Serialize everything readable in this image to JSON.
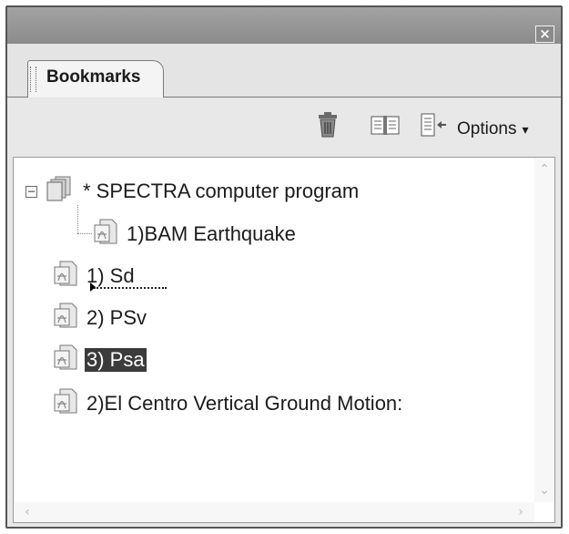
{
  "window": {
    "close_icon": "close-icon"
  },
  "tabs": [
    {
      "label": "Bookmarks"
    }
  ],
  "toolbar": {
    "delete_icon": "trash-icon",
    "expand_icon": "open-book-icon",
    "goto_icon": "page-arrow-icon",
    "options_label": "Options",
    "options_caret": "▾"
  },
  "tree": {
    "items": [
      {
        "label": "* SPECTRA computer program",
        "icon": "document-stack-icon",
        "expanded": true,
        "level": 0
      },
      {
        "label": "1)BAM Earthquake",
        "icon": "bookmark-page-icon",
        "level": 1
      },
      {
        "label": "1) Sd",
        "icon": "bookmark-page-icon",
        "level": 0
      },
      {
        "label": "2) PSv",
        "icon": "bookmark-page-icon",
        "level": 0
      },
      {
        "label": "3) Psa",
        "icon": "bookmark-page-icon",
        "level": 0,
        "selected": true
      },
      {
        "label": "2)El Centro Vertical Ground Motion:",
        "icon": "bookmark-page-icon",
        "level": 0
      }
    ],
    "expander_symbol": "−"
  },
  "scrollbars": {
    "up": "⌃",
    "down": "⌄",
    "left": "‹",
    "right": "›"
  }
}
